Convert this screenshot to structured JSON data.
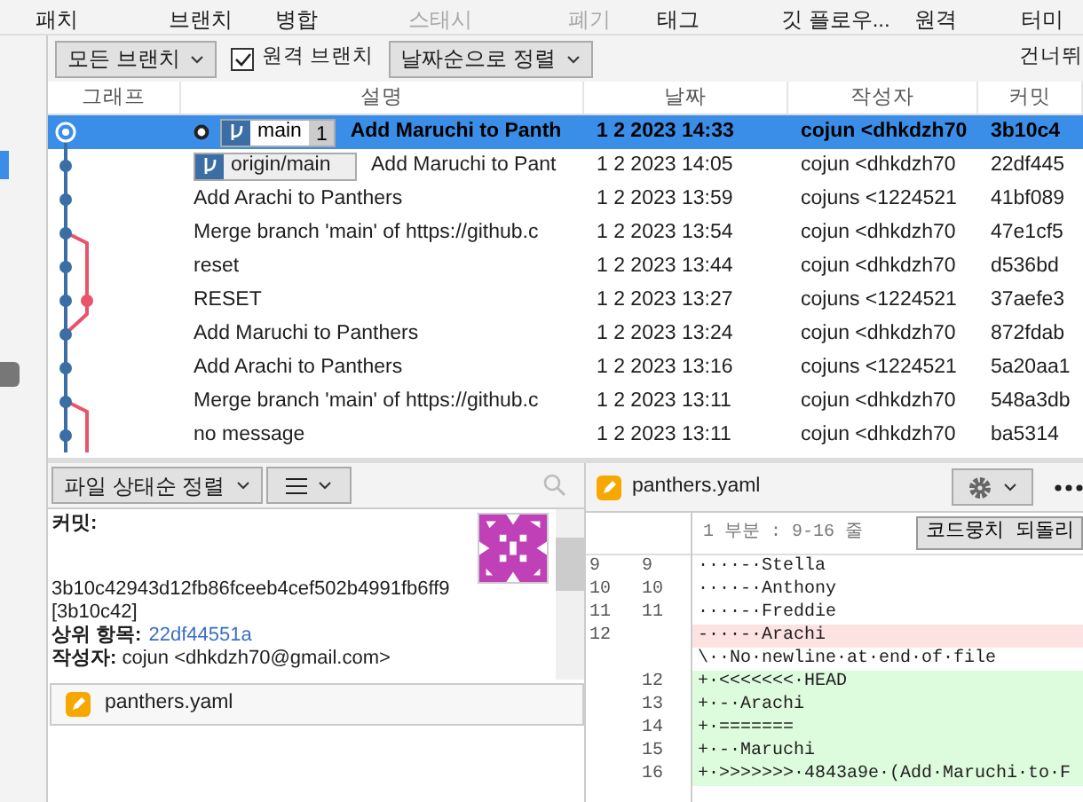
{
  "toolbar": [
    {
      "label": "패치",
      "disabled": false
    },
    {
      "label": "브랜치",
      "disabled": false
    },
    {
      "label": "병합",
      "disabled": false
    },
    {
      "label": "스태시",
      "disabled": true
    },
    {
      "label": "폐기",
      "disabled": true
    },
    {
      "label": "태그",
      "disabled": false
    },
    {
      "label": "깃 플로우...",
      "disabled": false
    },
    {
      "label": "원격",
      "disabled": false
    },
    {
      "label": "터미",
      "disabled": false
    }
  ],
  "filter_bar": {
    "branch_dropdown": "모든 브랜치",
    "remote_checkbox": {
      "label": "원격 브랜치",
      "checked": true
    },
    "sort_dropdown": "날짜순으로 정렬",
    "skip_label": "건너뛰"
  },
  "table": {
    "columns": [
      "그래프",
      "설명",
      "날짜",
      "작성자",
      "커밋"
    ],
    "rows": [
      {
        "selected": true,
        "refs": [
          {
            "kind": "local",
            "name": "main",
            "count": "1"
          }
        ],
        "description": "Add Maruchi to Panth",
        "date": "1 2 2023 14:33",
        "author": "cojun <dhkdzh70",
        "commit": "3b10c4"
      },
      {
        "selected": false,
        "refs": [
          {
            "kind": "remote",
            "name": "origin/main"
          }
        ],
        "description": "Add Maruchi to Pant",
        "date": "1 2 2023 14:05",
        "author": "cojun <dhkdzh70",
        "commit": "22df445"
      },
      {
        "selected": false,
        "description": "Add Arachi to Panthers",
        "date": "1 2 2023 13:59",
        "author": "cojuns <1224521",
        "commit": "41bf089"
      },
      {
        "selected": false,
        "description": "Merge branch 'main' of https://github.c",
        "date": "1 2 2023 13:54",
        "author": "cojun <dhkdzh70",
        "commit": "47e1cf5"
      },
      {
        "selected": false,
        "description": "reset",
        "date": "1 2 2023 13:44",
        "author": "cojun <dhkdzh70",
        "commit": "d536bd"
      },
      {
        "selected": false,
        "description": "RESET",
        "date": "1 2 2023 13:27",
        "author": "cojuns <1224521",
        "commit": "37aefe3"
      },
      {
        "selected": false,
        "description": "Add Maruchi to Panthers",
        "date": "1 2 2023 13:24",
        "author": "cojun <dhkdzh70",
        "commit": "872fdab"
      },
      {
        "selected": false,
        "description": "Add Arachi to Panthers",
        "date": "1 2 2023 13:16",
        "author": "cojuns <1224521",
        "commit": "5a20aa1"
      },
      {
        "selected": false,
        "description": "Merge branch 'main' of https://github.c",
        "date": "1 2 2023 13:11",
        "author": "cojun <dhkdzh70",
        "commit": "548a3db"
      },
      {
        "selected": false,
        "description": "no message",
        "date": "1 2 2023 13:11",
        "author": "cojun <dhkdzh70",
        "commit": "ba5314"
      }
    ]
  },
  "file_panel": {
    "sort_dropdown": "파일 상태순 정렬",
    "details": {
      "commit_label": "커밋:",
      "hash": "3b10c42943d12fb86fceeb4cef502b4991fb6ff9",
      "short_hash": "[3b10c42]",
      "parent_label": "상위 항목:",
      "parent_link": "22df44551a",
      "author_line": "**작성자:** cojun <dhkdzh70@gmail.com>"
    },
    "files": [
      {
        "name": "panthers.yaml"
      }
    ]
  },
  "diff": {
    "file": "panthers.yaml",
    "hunk_header": "1 부분 : 9-16 줄",
    "revert_button": "코드뭉치 되돌리",
    "lines": [
      {
        "kind": "context",
        "old": "9",
        "new": "9",
        "text": "····-·Stella"
      },
      {
        "kind": "context",
        "old": "10",
        "new": "10",
        "text": "····-·Anthony"
      },
      {
        "kind": "context",
        "old": "11",
        "new": "11",
        "text": "····-·Freddie"
      },
      {
        "kind": "removed",
        "old": "12",
        "text": "-···-·Arachi"
      },
      {
        "kind": "note",
        "text": "\\··No·newline·at·end·of·file"
      },
      {
        "kind": "added",
        "new": "12",
        "text": "+·<<<<<<<·HEAD"
      },
      {
        "kind": "added",
        "new": "13",
        "text": "+·-·Arachi"
      },
      {
        "kind": "added",
        "new": "14",
        "text": "+·======="
      },
      {
        "kind": "added",
        "new": "15",
        "text": "+·-·Maruchi"
      },
      {
        "kind": "added",
        "new": "16",
        "text": "+·>>>>>>>·4843a9e·(Add·Maruchi·to·F"
      }
    ]
  }
}
